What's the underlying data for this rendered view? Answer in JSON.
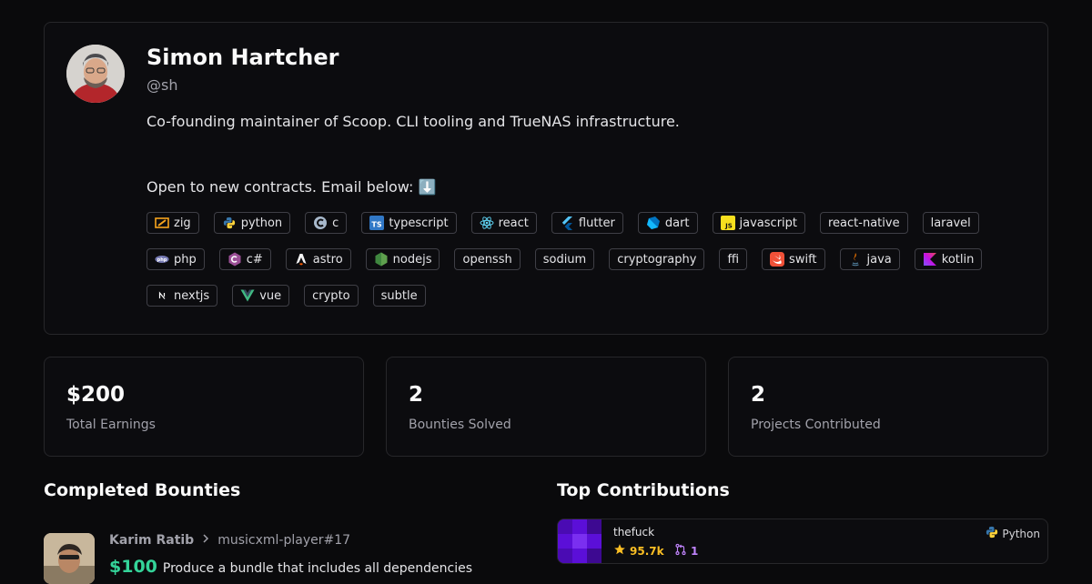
{
  "profile": {
    "name": "Simon Hartcher",
    "handle": "@sh",
    "bio": "Co-founding maintainer of Scoop. CLI tooling and TrueNAS infrastructure.\n\n\nOpen to new contracts. Email below: ⬇️",
    "tags": [
      {
        "label": "zig",
        "icon": "zig-icon"
      },
      {
        "label": "python",
        "icon": "python-icon"
      },
      {
        "label": "c",
        "icon": "c-icon"
      },
      {
        "label": "typescript",
        "icon": "typescript-icon"
      },
      {
        "label": "react",
        "icon": "react-icon"
      },
      {
        "label": "flutter",
        "icon": "flutter-icon"
      },
      {
        "label": "dart",
        "icon": "dart-icon"
      },
      {
        "label": "javascript",
        "icon": "javascript-icon"
      },
      {
        "label": "react-native",
        "icon": ""
      },
      {
        "label": "laravel",
        "icon": ""
      },
      {
        "label": "php",
        "icon": "php-icon"
      },
      {
        "label": "c#",
        "icon": "csharp-icon"
      },
      {
        "label": "astro",
        "icon": "astro-icon"
      },
      {
        "label": "nodejs",
        "icon": "nodejs-icon"
      },
      {
        "label": "openssh",
        "icon": ""
      },
      {
        "label": "sodium",
        "icon": ""
      },
      {
        "label": "cryptography",
        "icon": ""
      },
      {
        "label": "ffi",
        "icon": ""
      },
      {
        "label": "swift",
        "icon": "swift-icon"
      },
      {
        "label": "java",
        "icon": "java-icon"
      },
      {
        "label": "kotlin",
        "icon": "kotlin-icon"
      },
      {
        "label": "nextjs",
        "icon": "nextjs-icon"
      },
      {
        "label": "vue",
        "icon": "vue-icon"
      },
      {
        "label": "crypto",
        "icon": ""
      },
      {
        "label": "subtle",
        "icon": ""
      }
    ]
  },
  "stats": [
    {
      "value": "$200",
      "label": "Total Earnings"
    },
    {
      "value": "2",
      "label": "Bounties Solved"
    },
    {
      "value": "2",
      "label": "Projects Contributed"
    }
  ],
  "sections": {
    "completed_bounties": "Completed Bounties",
    "top_contributions": "Top Contributions"
  },
  "bounty": {
    "sponsor": "Karim Ratib",
    "issue": "musicxml-player#17",
    "amount": "$100",
    "title": "Produce a bundle that includes all dependencies"
  },
  "contribution": {
    "repo": "thefuck",
    "stars": "95.7k",
    "prs": "1",
    "language": "Python"
  },
  "colors": {
    "background": "#0a0a0c",
    "border": "#27272a",
    "bounty_amount": "#34d399",
    "stars": "#fbbf24",
    "prs": "#c084fc"
  }
}
